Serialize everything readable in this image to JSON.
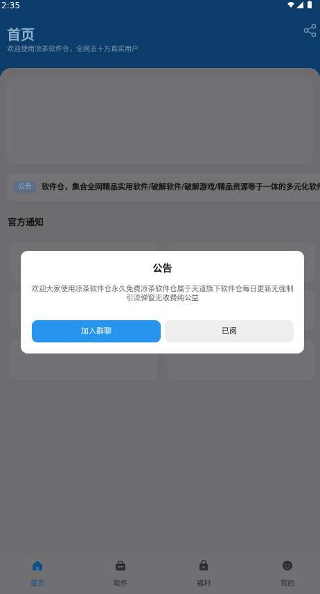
{
  "status_bar": {
    "time": "2:35"
  },
  "header": {
    "title": "首页",
    "subtitle": "欢迎使用凉茶软件仓，全网五十万真实用户"
  },
  "notice": {
    "tag": "公告",
    "text": "软件仓，集合全网精品实用软件/破解软件/破解游戏/精品资源等于一体的多元化软件，"
  },
  "section": {
    "title": "官方通知"
  },
  "tabs": [
    {
      "label": "首页",
      "icon": "home-icon",
      "active": true
    },
    {
      "label": "软件",
      "icon": "briefcase-icon",
      "active": false
    },
    {
      "label": "福利",
      "icon": "bag-icon",
      "active": false
    },
    {
      "label": "我的",
      "icon": "profile-icon",
      "active": false
    }
  ],
  "dialog": {
    "title": "公告",
    "body": "欢迎大家使用凉茶软件仓永久免费凉茶软件仓属于天道旗下软件仓每日更新无强制引流弹窗无收费纯公益",
    "primary_button": "加入群聊",
    "secondary_button": "已阅"
  },
  "colors": {
    "accent": "#2794ee",
    "header": "#0c3c6a",
    "overlay": "#6d6d70"
  }
}
